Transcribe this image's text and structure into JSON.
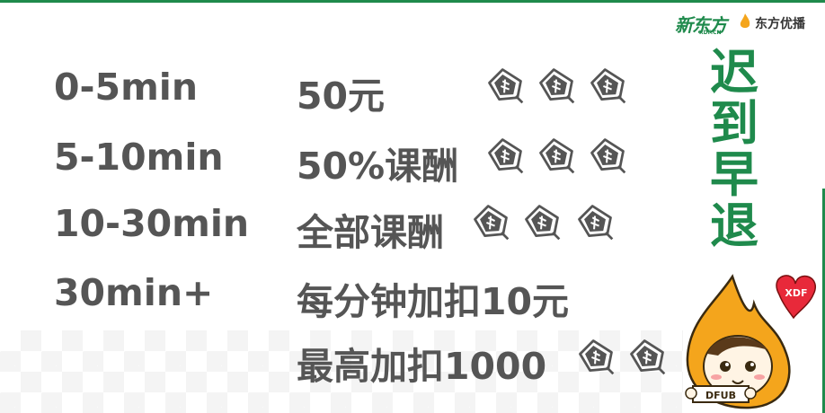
{
  "logos": {
    "xdf": "新东方",
    "xdf_sub": "XDF.CN",
    "dfyb": "东方优播"
  },
  "side_title": [
    "迟",
    "到",
    "早",
    "退"
  ],
  "rules": [
    {
      "time": "0-5min",
      "penalty": "50元"
    },
    {
      "time": "5-10min",
      "penalty": "50%课酬"
    },
    {
      "time": "10-30min",
      "penalty": "全部课酬"
    },
    {
      "time": "30min+",
      "penalty": "每分钟加扣10元"
    },
    {
      "time": "",
      "penalty": "最高加扣1000"
    }
  ],
  "mascot": {
    "heart_text": "XDF",
    "sign_text": "DFUB"
  },
  "colors": {
    "brand_green": "#1f8a4c",
    "text_gray": "#555555",
    "mascot_orange": "#f4a51c",
    "heart_red": "#e8293a"
  },
  "icons": [
    "money-bag-icon"
  ]
}
